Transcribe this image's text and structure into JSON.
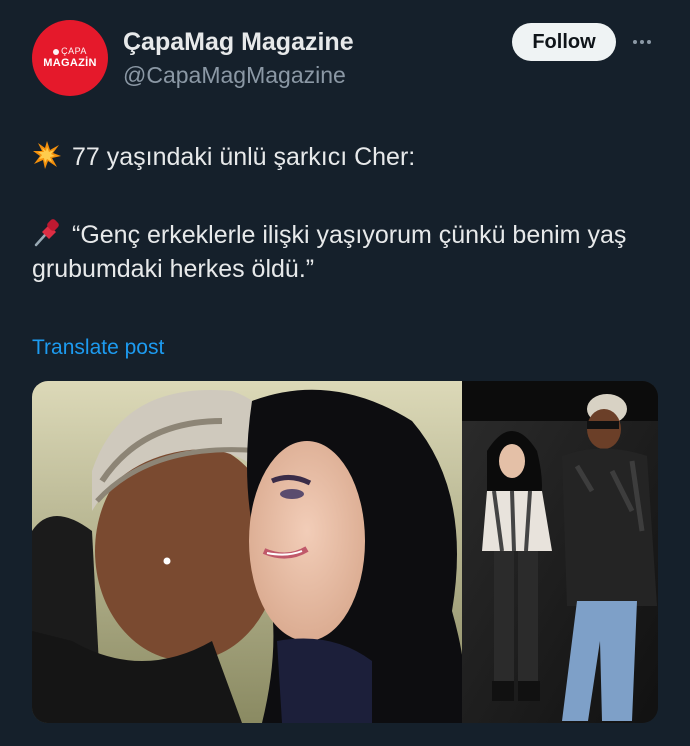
{
  "author": {
    "avatar_top": "ÇAPA",
    "avatar_bottom": "MAGAZİN",
    "name": "ÇapaMag Magazine",
    "handle": "@CapaMagMagazine"
  },
  "actions": {
    "follow_label": "Follow"
  },
  "post": {
    "line1_icon": "collision-emoji",
    "line1": "77 yaşındaki ünlü şarkıcı Cher:",
    "line2_icon": "pushpin-emoji",
    "line2": "“Genç erkeklerle ilişki yaşıyorum çünkü benim yaş grubumdaki herkes öldü.”",
    "translate_label": "Translate post"
  },
  "colors": {
    "background": "#15202b",
    "text": "#e7e9ea",
    "secondary": "#8b98a5",
    "link": "#1d9bf0",
    "brand": "#e5192b"
  }
}
